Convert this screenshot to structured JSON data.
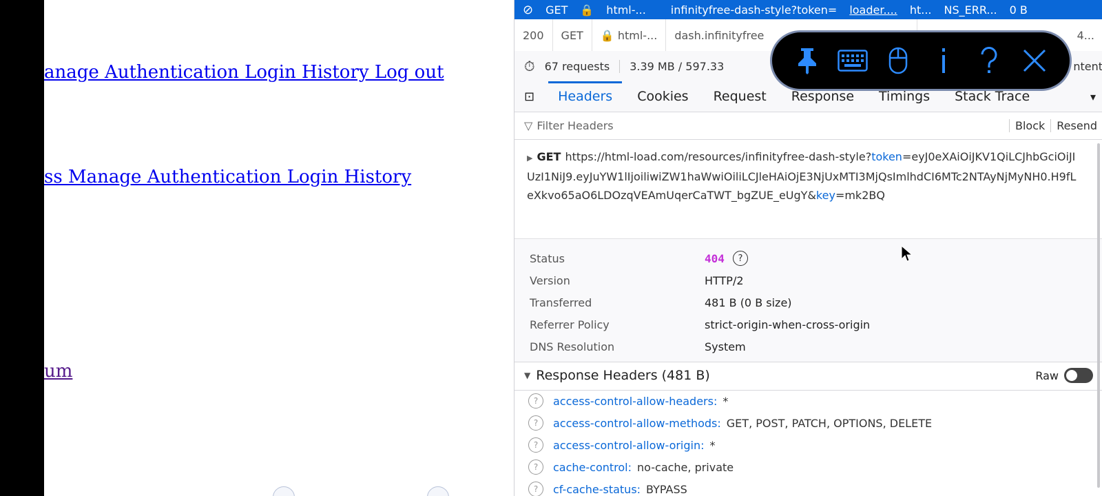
{
  "page": {
    "links": [
      "anage Authentication Login History Log out",
      "ss Manage Authentication Login History",
      "um"
    ]
  },
  "devtools": {
    "selected_row": [
      "GET",
      "html-...",
      "infinityfree-dash-style?token=",
      "loader....",
      "ht...",
      "NS_ERR...",
      "0 B"
    ],
    "row2": [
      "200",
      "GET",
      "html-...",
      "dash.infinityfree",
      "4..."
    ],
    "summary": {
      "requests": "67 requests",
      "size": "3.39 MB / 597.33",
      "tail": "ntent"
    },
    "tabs": [
      "Headers",
      "Cookies",
      "Request",
      "Response",
      "Timings",
      "Stack Trace"
    ],
    "filter_placeholder": "Filter Headers",
    "block": "Block",
    "resend": "Resend",
    "method": "GET",
    "url_pre": "https://html-load.com/resources/infinityfree-dash-style?",
    "url_token_key": "token",
    "url_token_val": "=eyJ0eXAiOiJKV1QiLCJhbGciOiJIUzI1NiJ9.eyJuYW1lIjoiliwiZW1haWwiOiliLCJleHAiOjE3NjUxMTI3MjQsImlhdCI6MTc2NTAyNjMyNH0.H9fLeXkvo65aO6LDOzqVEAmUqerCaTWT_bgZUE_eUgY&",
    "url_key_key": "key",
    "url_key_val": "=mk2BQ",
    "status": {
      "status_label": "Status",
      "status_value": "404",
      "version_label": "Version",
      "version_value": "HTTP/2",
      "transferred_label": "Transferred",
      "transferred_value": "481 B (0 B size)",
      "referrer_label": "Referrer Policy",
      "referrer_value": "strict-origin-when-cross-origin",
      "dns_label": "DNS Resolution",
      "dns_value": "System"
    },
    "response_headers_title": "Response Headers (481 B)",
    "raw_label": "Raw",
    "headers": [
      {
        "name": "access-control-allow-headers:",
        "value": "*"
      },
      {
        "name": "access-control-allow-methods:",
        "value": "GET, POST, PATCH, OPTIONS, DELETE"
      },
      {
        "name": "access-control-allow-origin:",
        "value": "*"
      },
      {
        "name": "cache-control:",
        "value": "no-cache, private"
      },
      {
        "name": "cf-cache-status:",
        "value": "BYPASS"
      }
    ]
  },
  "overlay": {
    "buttons": [
      "pin-icon",
      "keyboard-icon",
      "mouse-icon",
      "info-icon",
      "help-icon",
      "close-icon"
    ],
    "accent": "#2d8bff"
  },
  "colors": {
    "accent": "#0a68d8",
    "status_404": "#c430d8"
  }
}
